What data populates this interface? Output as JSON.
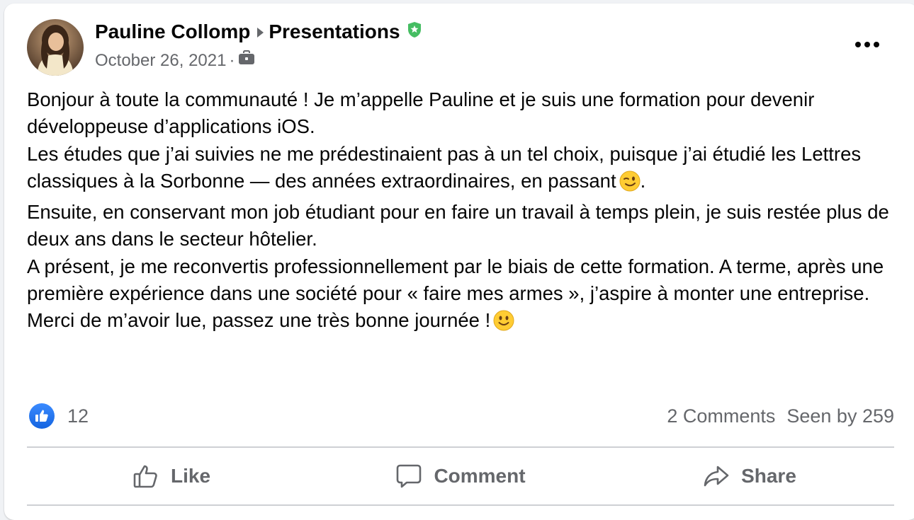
{
  "post": {
    "author": "Pauline Collomp",
    "group": "Presentations",
    "date": "October 26, 2021",
    "meta_separator": "·",
    "icons": {
      "avatar": "profile-photo",
      "caret": "triangle-right-icon",
      "admin": "shield-badge-icon",
      "audience": "briefcase-icon",
      "more": "more-options-icon"
    },
    "paragraphs": [
      "Bonjour à toute la communauté ! Je m’appelle Pauline et je suis une formation pour devenir développeuse d’applications iOS.",
      "Les études que j’ai suivies ne me prédestinaient pas à un tel choix, puisque j’ai étudié les Lettres classiques à la Sorbonne — des années extraordinaires, en passant",
      "Ensuite, en conservant mon job étudiant pour en faire un travail à temps plein, je suis restée plus de deux ans dans le secteur hôtelier.",
      "A présent, je me reconvertis professionnellement par le biais de cette formation. A terme, après une première expérience dans une société pour « faire mes armes », j’aspire à monter une entreprise.",
      "Merci de m’avoir lue, passez une très bonne journée !"
    ],
    "paragraph_2_suffix": ".",
    "emojis": [
      "winking-face-emoji",
      "slightly-smiling-face-emoji"
    ]
  },
  "stats": {
    "reaction_count": "12",
    "comments": "2 Comments",
    "seen_by": "Seen by 259"
  },
  "actions": {
    "like": "Like",
    "comment": "Comment",
    "share": "Share"
  },
  "colors": {
    "admin_badge": "#45bd62",
    "like_blue": "#1877f2",
    "secondary_text": "#65676b",
    "divider": "#ced0d4"
  }
}
